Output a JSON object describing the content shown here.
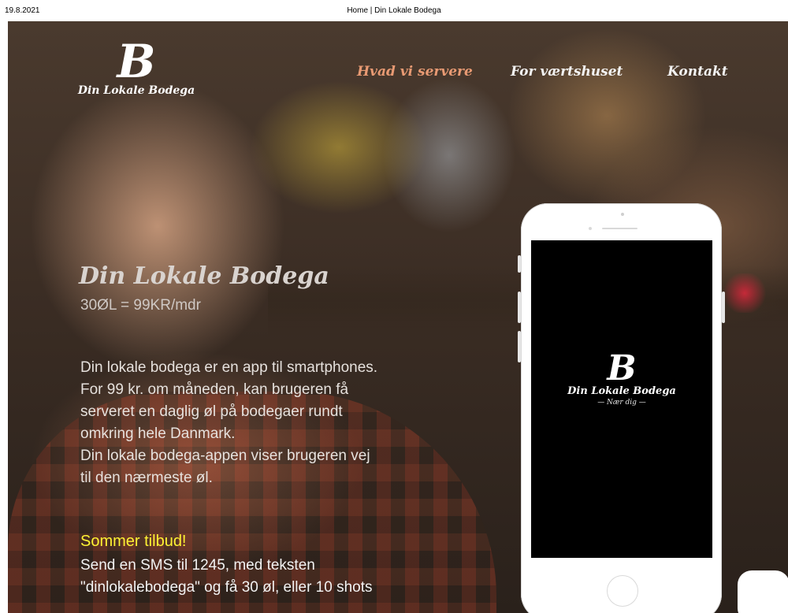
{
  "print_header": {
    "date": "19.8.2021",
    "title": "Home | Din Lokale Bodega"
  },
  "logo": {
    "mark": "B",
    "text": "Din Lokale Bodega",
    "icon": "bodega-b-logo-icon"
  },
  "nav": {
    "items": [
      {
        "label": "Hvad vi servere",
        "active": true
      },
      {
        "label": "For værtshuset",
        "active": false
      },
      {
        "label": "Kontakt",
        "active": false
      }
    ]
  },
  "hero": {
    "title": "Din Lokale Bodega",
    "price": "30ØL = 99KR/mdr",
    "description_lines": [
      "Din lokale bodega er en app til smartphones.",
      "For 99 kr. om måneden, kan brugeren få",
      "serveret en daglig øl på bodegaer rundt",
      "omkring hele Danmark.",
      "Din lokale bodega-appen viser brugeren vej",
      "til den nærmeste øl."
    ],
    "offer_title": "Sommer tilbud!",
    "offer_lines": [
      "Send en SMS til 1245, med teksten",
      "\"dinlokalebodega\" og få 30 øl, eller 10 shots"
    ]
  },
  "phone": {
    "screen_mark": "B",
    "screen_name": "Din Lokale Bodega",
    "screen_tagline": "— Nær dig —"
  },
  "colors": {
    "nav_active": "#e89a73",
    "offer_highlight": "#fff233",
    "phone_screen": "#000000"
  }
}
